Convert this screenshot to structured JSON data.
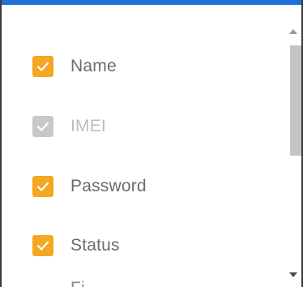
{
  "list": {
    "items": [
      {
        "label": "Name",
        "checked": true,
        "disabled": false
      },
      {
        "label": "IMEI",
        "checked": true,
        "disabled": true
      },
      {
        "label": "Password",
        "checked": true,
        "disabled": false
      },
      {
        "label": "Status",
        "checked": true,
        "disabled": false
      },
      {
        "label": "Fi",
        "checked": false,
        "disabled": false
      }
    ]
  },
  "colors": {
    "accent": "#f5a623",
    "disabled": "#c8c8c8",
    "top_bar": "#1e6fd9"
  },
  "icons": {
    "check": "check-icon",
    "scroll_up": "scroll-up-icon",
    "scroll_down": "scroll-down-icon"
  }
}
